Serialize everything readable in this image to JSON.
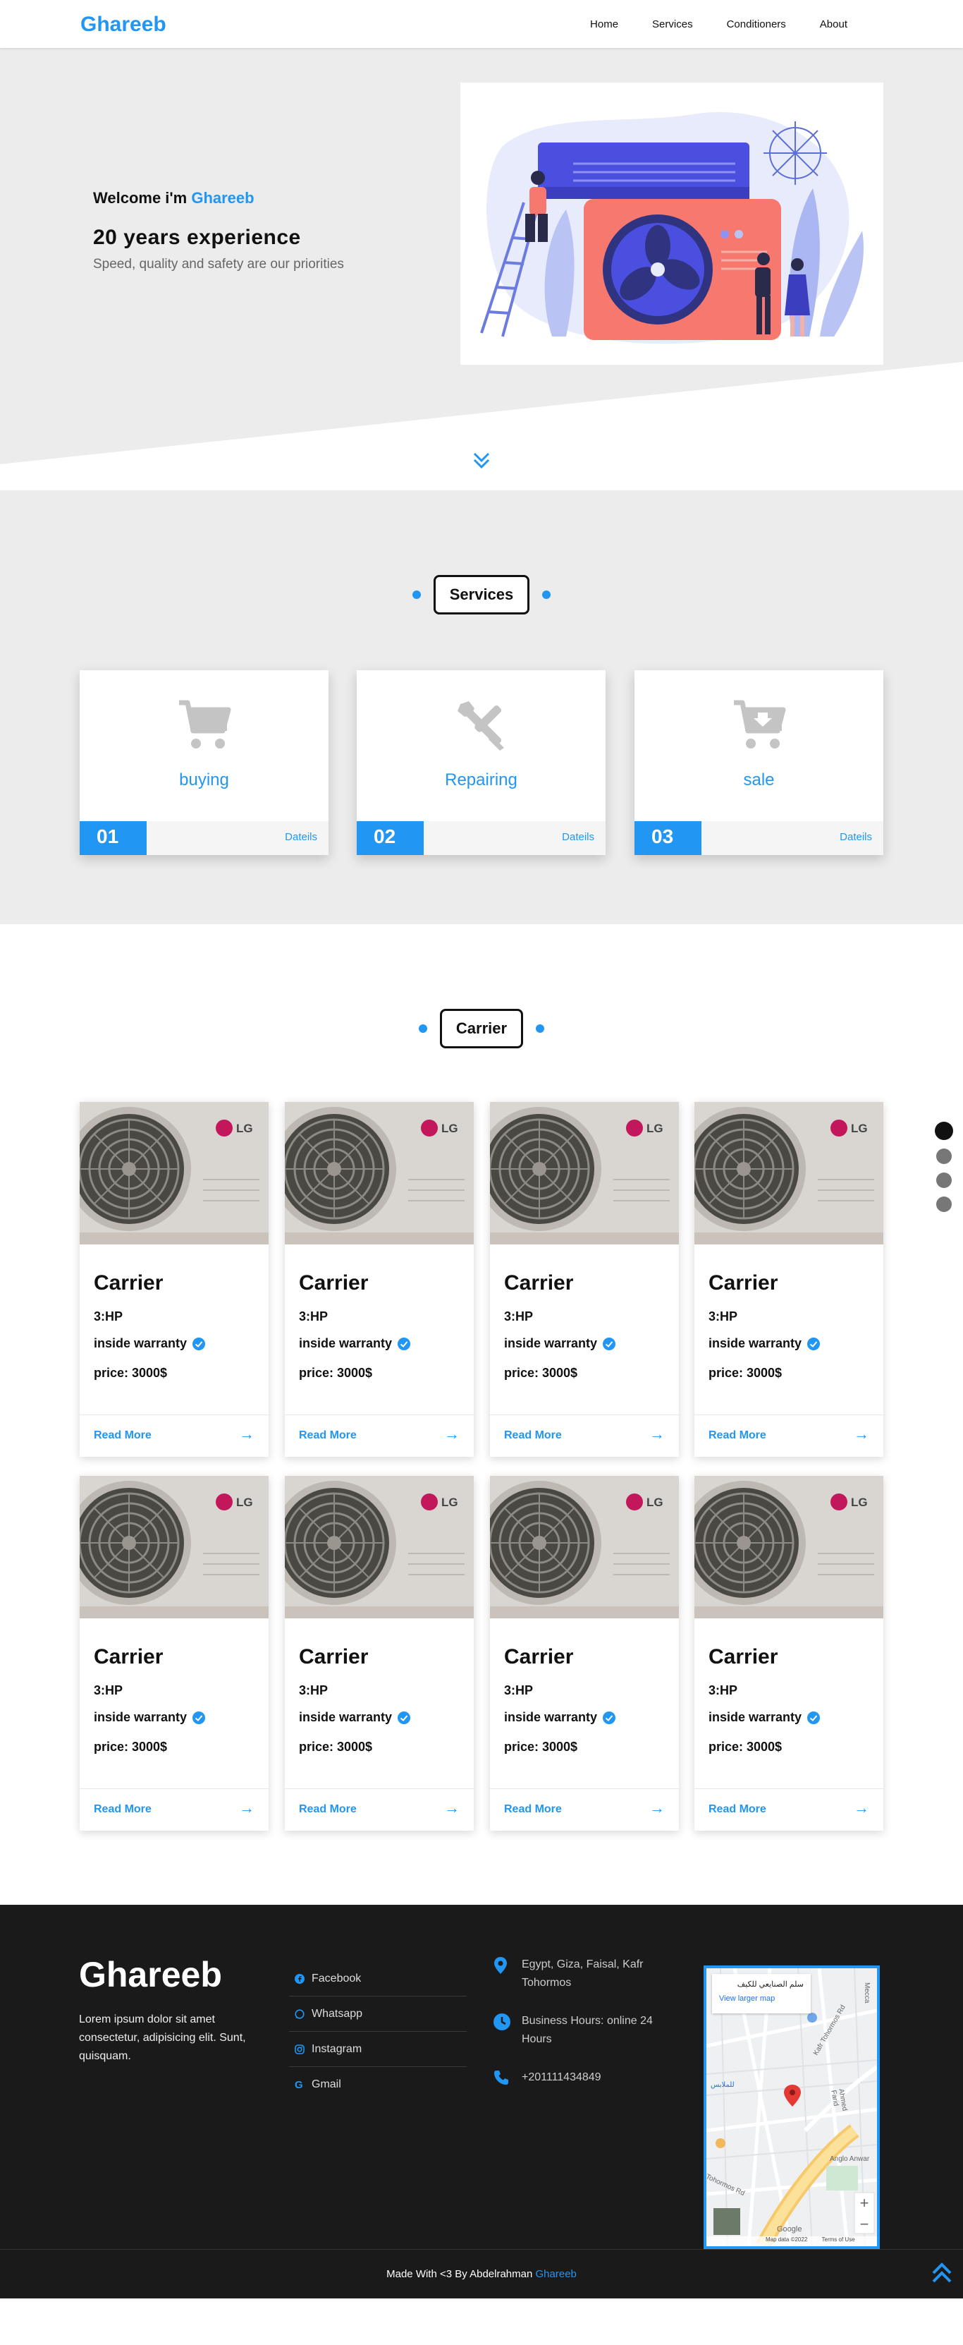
{
  "header": {
    "logo": "Ghareeb",
    "nav": [
      "Home",
      "Services",
      "Conditioners",
      "About"
    ]
  },
  "hero": {
    "welcome_prefix": "Welcome i'm",
    "welcome_name": "Ghareeb",
    "headline": "20 years experience",
    "tagline": "Speed, quality and safety are our priorities"
  },
  "services": {
    "title": "Services",
    "cards": [
      {
        "name": "buying",
        "number": "01",
        "link": "Dateils",
        "icon": "cart-icon"
      },
      {
        "name": "Repairing",
        "number": "02",
        "link": "Dateils",
        "icon": "tools-icon"
      },
      {
        "name": "sale",
        "number": "03",
        "link": "Dateils",
        "icon": "cart-sale-icon"
      }
    ]
  },
  "carrier": {
    "title": "Carrier",
    "products": [
      {
        "name": "Carrier",
        "hp": "3:HP",
        "warranty": "inside warranty",
        "price": "price: 3000$",
        "link": "Read More",
        "brand": "LG"
      },
      {
        "name": "Carrier",
        "hp": "3:HP",
        "warranty": "inside warranty",
        "price": "price: 3000$",
        "link": "Read More",
        "brand": "LG"
      },
      {
        "name": "Carrier",
        "hp": "3:HP",
        "warranty": "inside warranty",
        "price": "price: 3000$",
        "link": "Read More",
        "brand": "LG"
      },
      {
        "name": "Carrier",
        "hp": "3:HP",
        "warranty": "inside warranty",
        "price": "price: 3000$",
        "link": "Read More",
        "brand": "LG"
      },
      {
        "name": "Carrier",
        "hp": "3:HP",
        "warranty": "inside warranty",
        "price": "price: 3000$",
        "link": "Read More",
        "brand": "LG"
      },
      {
        "name": "Carrier",
        "hp": "3:HP",
        "warranty": "inside warranty",
        "price": "price: 3000$",
        "link": "Read More",
        "brand": "LG"
      },
      {
        "name": "Carrier",
        "hp": "3:HP",
        "warranty": "inside warranty",
        "price": "price: 3000$",
        "link": "Read More",
        "brand": "LG"
      },
      {
        "name": "Carrier",
        "hp": "3:HP",
        "warranty": "inside warranty",
        "price": "price: 3000$",
        "link": "Read More",
        "brand": "LG"
      }
    ],
    "bullets_active_index": 0
  },
  "footer": {
    "logo": "Ghareeb",
    "description": "Lorem ipsum dolor sit amet consectetur, adipisicing elit. Sunt, quisquam.",
    "links": [
      "Facebook",
      "Whatsapp",
      "Instagram",
      "Gmail"
    ],
    "address": "Egypt, Giza, Faisal, Kafr Tohormos",
    "hours": "Business Hours: online 24 Hours",
    "phone": "+201111434849",
    "map": {
      "place": "سلم الصنايعي للكيف",
      "link": "View larger map",
      "labels": [
        "Mecca",
        "Kafr Tohormos Rd",
        "Anglo Anwar",
        "Tohormos Rd",
        "Ahmed Farid",
        "للملابس"
      ],
      "attribution": "Map data ©2022",
      "terms": "Terms of Use",
      "google": "Google"
    },
    "made_prefix": "Made With <3 By Abdelrahman",
    "made_name": "Ghareeb"
  },
  "colors": {
    "accent": "#2196f3",
    "footer_bg": "#1a1a1b",
    "hero_bg": "#ececec"
  }
}
